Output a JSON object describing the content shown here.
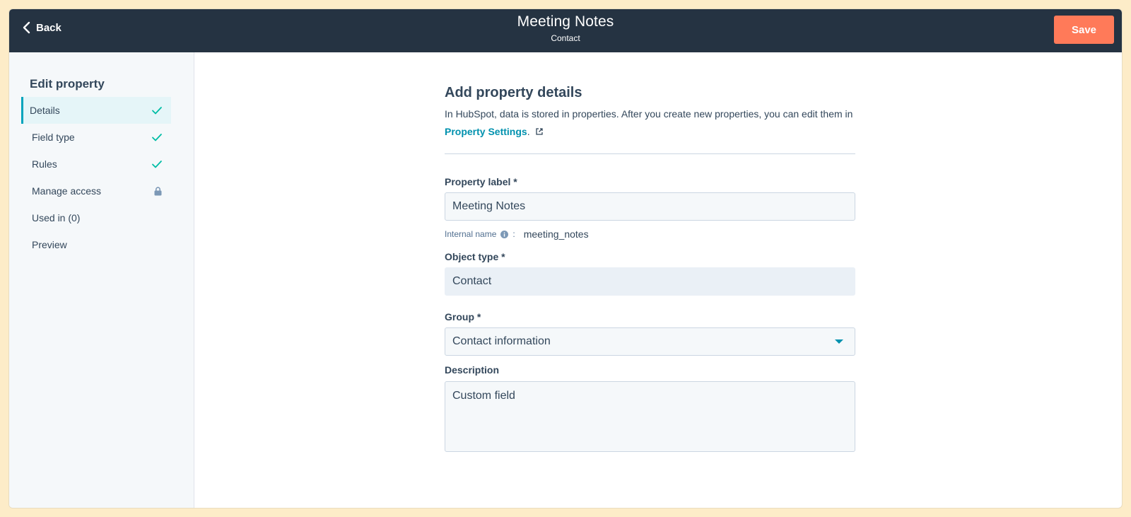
{
  "header": {
    "back_label": "Back",
    "title": "Meeting Notes",
    "subtitle": "Contact",
    "save_label": "Save"
  },
  "sidebar": {
    "heading": "Edit property",
    "items": [
      {
        "label": "Details",
        "status": "check-icon",
        "active": true
      },
      {
        "label": "Field type",
        "status": "check-icon"
      },
      {
        "label": "Rules",
        "status": "check-icon"
      },
      {
        "label": "Manage access",
        "status": "lock-icon"
      },
      {
        "label": "Used in (0)"
      },
      {
        "label": "Preview"
      }
    ]
  },
  "main": {
    "heading": "Add property details",
    "intro_text": "In HubSpot, data is stored in properties. After you create new properties, you can edit them in",
    "settings_link": "Property Settings",
    "intro_end": ".",
    "property_label": {
      "label": "Property label *",
      "value": "Meeting Notes"
    },
    "internal_name": {
      "label": "Internal name",
      "separator": ":",
      "value": "meeting_notes"
    },
    "object_type": {
      "label": "Object type *",
      "value": "Contact"
    },
    "group": {
      "label": "Group *",
      "value": "Contact information"
    },
    "description": {
      "label": "Description",
      "value": "Custom field"
    }
  },
  "colors": {
    "header_bg": "#253342",
    "save_button": "#ff7a59",
    "accent": "#00a4bd",
    "link": "#0091ae",
    "check": "#00bda5"
  }
}
